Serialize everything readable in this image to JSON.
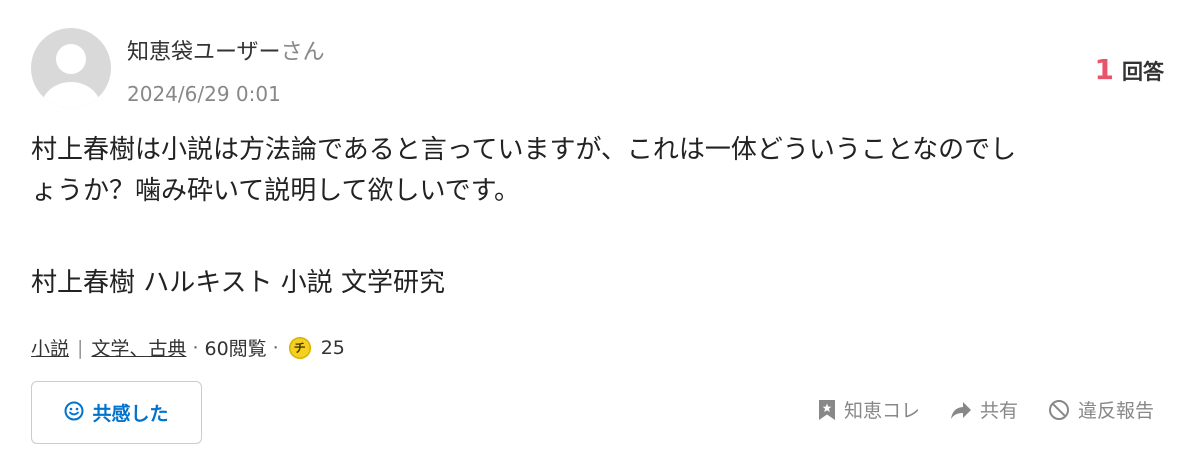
{
  "question": {
    "user_name": "知恵袋ユーザー",
    "user_suffix": "さん",
    "timestamp": "2024/6/29 0:01",
    "answer_count": "1",
    "answer_label": "回答",
    "body_lines": [
      "村上春樹は小説は方法論であると言っていますが、これは一体どういうことなのでし",
      "ょうか？噛み砕いて説明して欲しいです。"
    ],
    "tags_line": "村上春樹 ハルキスト 小説 文学研究"
  },
  "meta": {
    "category_1": "小説",
    "category_separator": "|",
    "category_2": "文学、古典",
    "views": "60閲覧",
    "coin_symbol": "チ",
    "coins": "25"
  },
  "actions": {
    "empathy_label": "共感した",
    "chiebukuro_label": "知恵コレ",
    "share_label": "共有",
    "report_label": "違反報告"
  },
  "icons": {
    "avatar": "default-avatar-icon",
    "empathy": "smile-icon",
    "chiebukuro": "bookmark-star-icon",
    "share": "share-arrow-icon",
    "report": "prohibited-icon"
  },
  "colors": {
    "accent_blue": "#0073cc",
    "answer_count": "#e9546b",
    "coin": "#f5d021",
    "muted": "#888888"
  }
}
